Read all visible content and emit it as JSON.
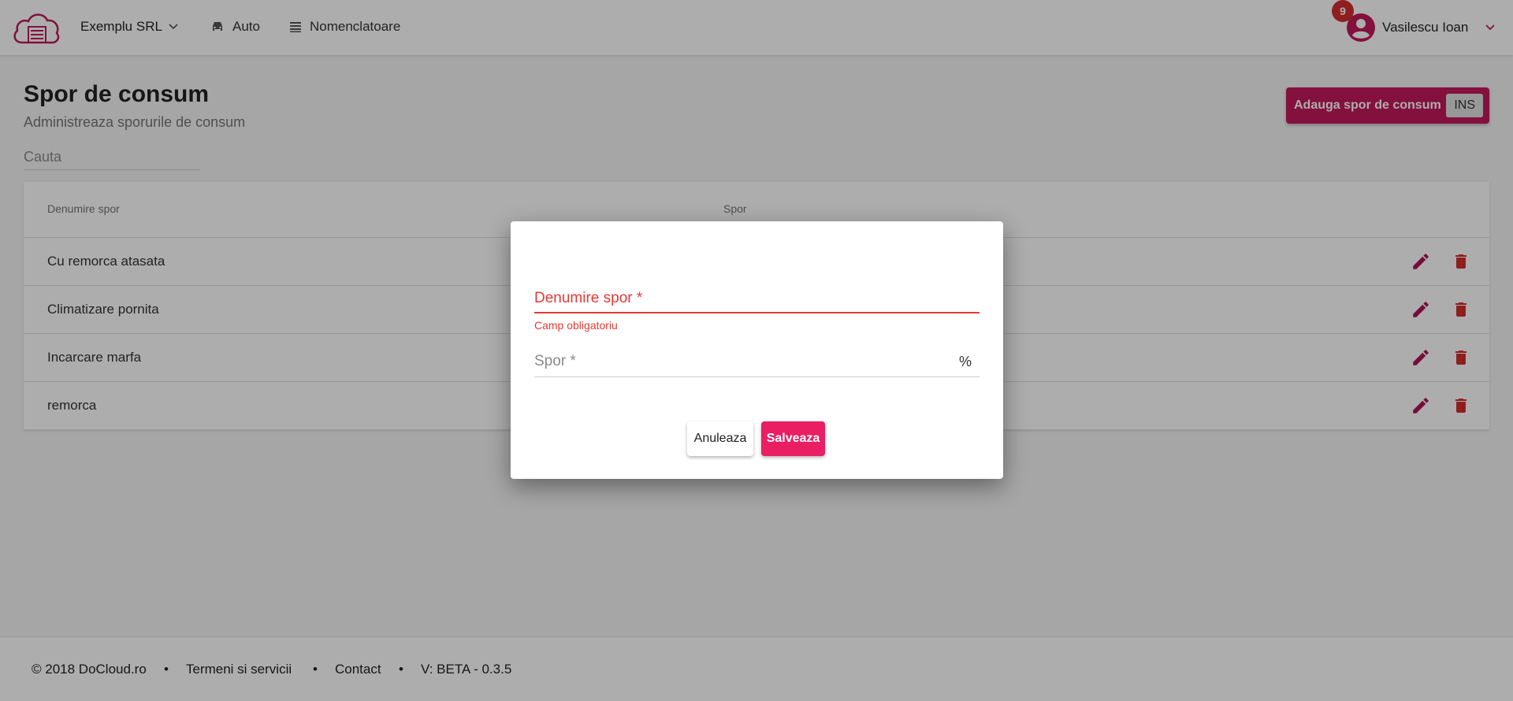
{
  "header": {
    "company": "Exemplu SRL",
    "nav": [
      {
        "label": "Auto",
        "icon": "car-icon"
      },
      {
        "label": "Nomenclatoare",
        "icon": "list-icon"
      }
    ],
    "user": {
      "name": "Vasilescu Ioan",
      "notifications": "9"
    }
  },
  "page": {
    "title": "Spor de consum",
    "subtitle": "Administreaza sporurile de consum",
    "search_placeholder": "Cauta",
    "add_button": "Adauga spor de consum",
    "add_shortcut": "INS"
  },
  "table": {
    "columns": [
      "Denumire spor",
      "Spor"
    ],
    "rows": [
      {
        "name": "Cu remorca atasata"
      },
      {
        "name": "Climatizare pornita"
      },
      {
        "name": "Incarcare marfa"
      },
      {
        "name": "remorca"
      }
    ]
  },
  "dialog": {
    "field1_label": "Denumire spor *",
    "field1_error": "Camp obligatoriu",
    "field2_label": "Spor *",
    "field2_suffix": "%",
    "cancel": "Anuleaza",
    "save": "Salveaza"
  },
  "footer": {
    "copyright": "© 2018 DoCloud.ro",
    "terms": "Termeni si servicii",
    "contact": "Contact",
    "version": "V: BETA - 0.3.5",
    "separator": "•"
  },
  "colors": {
    "accent": "#c2185b",
    "error": "#e53935",
    "save": "#e91e63",
    "delete": "#d32f2f"
  }
}
